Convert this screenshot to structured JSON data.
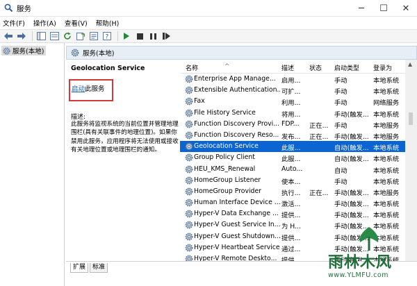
{
  "window": {
    "title": "服务",
    "minimize": "─",
    "maximize": "☐",
    "close": "✕"
  },
  "menu": [
    "文件(F)",
    "操作(A)",
    "查看(V)",
    "帮助(H)"
  ],
  "tree": {
    "item": "服务(本地)"
  },
  "panel": {
    "header": "服务(本地)"
  },
  "detail": {
    "service_title": "Geolocation Service",
    "start_link": "启动",
    "start_suffix": "此服务",
    "desc_label": "描述:",
    "desc_text": "此服务将监视系统的当前位置并管理地理围栏(具有关联事件的地理位置)。如果你禁用此服务，应用程序将无法使用或接收有关地理位置或地理围栏的通知。"
  },
  "columns": {
    "name": "名称",
    "desc": "描述",
    "status": "状态",
    "startup": "启动类型",
    "logon": "登录为"
  },
  "services": [
    {
      "name": "Enterprise App Manage...",
      "desc": "启用...",
      "status": "",
      "startup": "手动",
      "logon": "本地系统",
      "selected": false
    },
    {
      "name": "Extensible Authentication...",
      "desc": "可扩...",
      "status": "",
      "startup": "手动",
      "logon": "本地系统",
      "selected": false
    },
    {
      "name": "Fax",
      "desc": "利用...",
      "status": "",
      "startup": "手动",
      "logon": "网络服务",
      "selected": false
    },
    {
      "name": "File History Service",
      "desc": "将用...",
      "status": "",
      "startup": "手动(触发...",
      "logon": "本地系统",
      "selected": false
    },
    {
      "name": "Function Discovery Provi...",
      "desc": "FDP...",
      "status": "正在...",
      "startup": "手动",
      "logon": "本地服务",
      "selected": false
    },
    {
      "name": "Function Discovery Reso...",
      "desc": "发布...",
      "status": "正在...",
      "startup": "手动(触发...",
      "logon": "本地服务",
      "selected": false
    },
    {
      "name": "Geolocation Service",
      "desc": "此服...",
      "status": "",
      "startup": "自动(触发...",
      "logon": "本地系统",
      "selected": true
    },
    {
      "name": "Group Policy Client",
      "desc": "此服...",
      "status": "",
      "startup": "自动(触发...",
      "logon": "本地系统",
      "selected": false
    },
    {
      "name": "HEU_KMS_Renewal",
      "desc": "Auto...",
      "status": "",
      "startup": "自动",
      "logon": "本地系统",
      "selected": false
    },
    {
      "name": "HomeGroup Listener",
      "desc": "使本...",
      "status": "",
      "startup": "手动",
      "logon": "本地系统",
      "selected": false
    },
    {
      "name": "HomeGroup Provider",
      "desc": "执行...",
      "status": "正在...",
      "startup": "手动(触发...",
      "logon": "本地服务",
      "selected": false
    },
    {
      "name": "Human Interface Device ...",
      "desc": "激活...",
      "status": "",
      "startup": "手动(触发...",
      "logon": "本地系统",
      "selected": false
    },
    {
      "name": "Hyper-V Data Exchange ...",
      "desc": "提供...",
      "status": "",
      "startup": "手动(触发...",
      "logon": "本地系统",
      "selected": false
    },
    {
      "name": "Hyper-V Guest Service In...",
      "desc": "为 H...",
      "status": "",
      "startup": "手动(触发...",
      "logon": "本地系统",
      "selected": false
    },
    {
      "name": "Hyper-V Guest Shutdown...",
      "desc": "提供...",
      "status": "",
      "startup": "手动(触发...",
      "logon": "本地系统",
      "selected": false
    },
    {
      "name": "Hyper-V Heartbeat Service",
      "desc": "通过...",
      "status": "",
      "startup": "手动(触发...",
      "logon": "本地系统",
      "selected": false
    },
    {
      "name": "Hyper-V Remote Deskto...",
      "desc": "提供...",
      "status": "",
      "startup": "手动(触发...",
      "logon": "本地系统",
      "selected": false
    }
  ],
  "tabs": [
    "扩展",
    "标准"
  ],
  "watermark": {
    "text": "雨林木风",
    "url": "www.YLMFU.com"
  },
  "colors": {
    "selection": "#0a64d2",
    "link": "#1a5fb4",
    "highlight_box": "#d23a3a",
    "watermark": "#1f6f3a"
  }
}
